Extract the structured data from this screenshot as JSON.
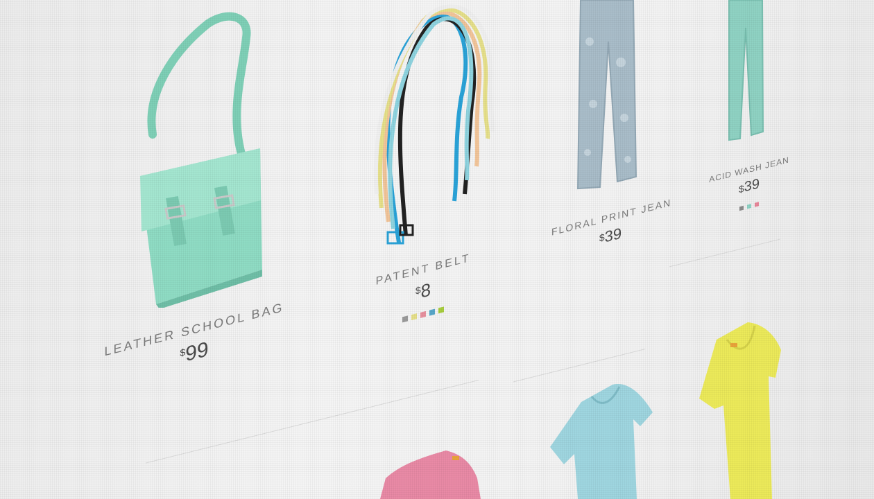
{
  "products": [
    {
      "name": "LEATHER SCHOOL BAG",
      "currency": "$",
      "price": "99",
      "image": "leather-school-bag-image",
      "swatches": []
    },
    {
      "name": "PATENT BELT",
      "currency": "$",
      "price": "8",
      "image": "patent-belt-image",
      "swatches": [
        "#9a9a9a",
        "#e6e08a",
        "#e7909e",
        "#58a7c9",
        "#a9cf3f"
      ]
    },
    {
      "name": "FLORAL PRINT JEAN",
      "currency": "$",
      "price": "39",
      "image": "floral-print-jean-image",
      "swatches": []
    },
    {
      "name": "ACID WASH JEAN",
      "currency": "$",
      "price": "39",
      "image": "acid-wash-jean-image",
      "swatches": [
        "#8c8c8c",
        "#8fd4c6",
        "#e8879a"
      ]
    },
    {
      "name": "",
      "currency": "",
      "price": "",
      "image": "pink-top-image",
      "swatches": []
    },
    {
      "name": "",
      "currency": "",
      "price": "",
      "image": "light-blue-tee-image",
      "swatches": []
    },
    {
      "name": "",
      "currency": "",
      "price": "",
      "image": "yellow-tee-image",
      "swatches": []
    }
  ],
  "colors": {
    "bag": "#8fdcc4",
    "floral_jean": "#a9bdc9",
    "acid_jean": "#8fd2c3",
    "pink_top": "#e98aa6",
    "blue_tee": "#9fd6e0",
    "yellow_tee": "#ecea5a"
  }
}
